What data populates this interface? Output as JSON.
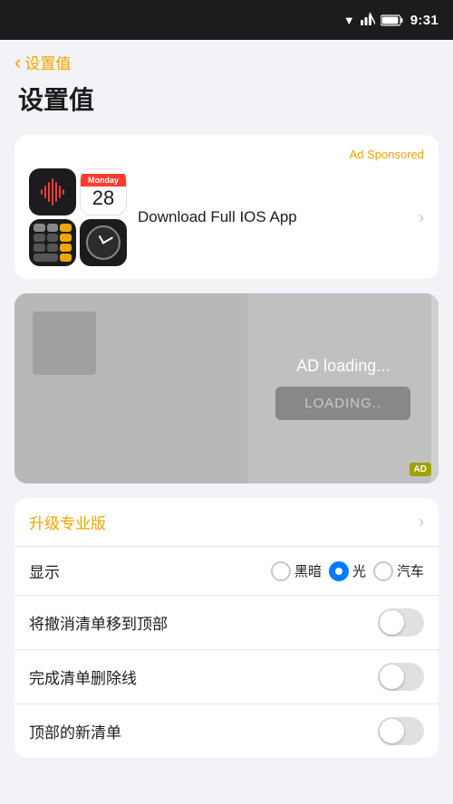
{
  "statusBar": {
    "time": "9:31",
    "icons": [
      "wifi",
      "signal-blocked",
      "battery"
    ]
  },
  "header": {
    "back_label": "设置值",
    "page_title": "设置值"
  },
  "adCard": {
    "sponsored_label": "Ad Sponsored",
    "download_label": "Download Full IOS App",
    "app_icons": [
      "voice-memos",
      "calendar",
      "calculator",
      "clock"
    ],
    "calendar_day_label": "Monday",
    "calendar_date": "28"
  },
  "adLoading": {
    "loading_text": "AD loading...",
    "loading_btn": "LOADING..",
    "ad_badge": "AD"
  },
  "settings": {
    "upgrade_label": "升级专业版",
    "display_label": "显示",
    "display_options": [
      {
        "id": "dark",
        "label": "黑暗",
        "checked": false
      },
      {
        "id": "light",
        "label": "光",
        "checked": true
      },
      {
        "id": "auto",
        "label": "汽车",
        "checked": false
      }
    ],
    "move_to_top_label": "将撤消清单移到顶部",
    "strikethrough_label": "完成清单删除线",
    "new_list_top_label": "顶部的新清单"
  }
}
